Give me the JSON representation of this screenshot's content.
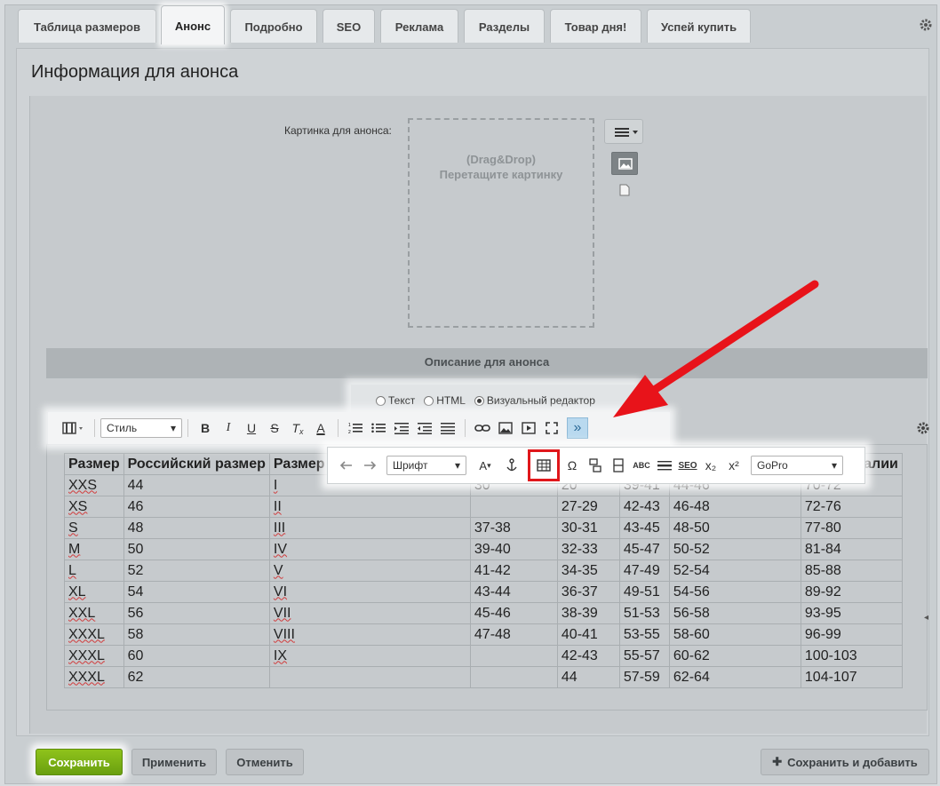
{
  "tabs": [
    "Таблица размеров",
    "Анонс",
    "Подробно",
    "SEO",
    "Реклама",
    "Разделы",
    "Товар дня!",
    "Успей купить"
  ],
  "active_tab": "Анонс",
  "page_title": "Информация для анонса",
  "picture": {
    "label": "Картинка для анонса:",
    "drop_line1": "(Drag&Drop)",
    "drop_line2": "Перетащите картинку"
  },
  "section_title": "Описание для анонса",
  "modes": [
    "Текст",
    "HTML",
    "Визуальный редактор"
  ],
  "selected_mode": "Визуальный редактор",
  "toolbar": {
    "style_select": "Стиль",
    "font_select": "Шрифт",
    "template_select": "GoPro",
    "font_size_label": "A",
    "more_label": "»",
    "subscript_label": "x₂",
    "superscript_label": "x²",
    "seo_label": "SEO",
    "spell_label": "ABC",
    "omega_label": "Ω"
  },
  "table": {
    "headers": [
      "Размер",
      "Российский размер",
      "Размер р",
      "",
      "",
      "",
      "",
      "алии"
    ],
    "rows": [
      [
        "XXS",
        "44",
        "I",
        "30",
        "20",
        "39-41",
        "44-46",
        "70-72"
      ],
      [
        "XS",
        "46",
        "II",
        "",
        "27-29",
        "42-43",
        "46-48",
        "72-76"
      ],
      [
        "S",
        "48",
        "III",
        "37-38",
        "30-31",
        "43-45",
        "48-50",
        "77-80"
      ],
      [
        "M",
        "50",
        "IV",
        "39-40",
        "32-33",
        "45-47",
        "50-52",
        "81-84"
      ],
      [
        "L",
        "52",
        "V",
        "41-42",
        "34-35",
        "47-49",
        "52-54",
        "85-88"
      ],
      [
        "XL",
        "54",
        "VI",
        "43-44",
        "36-37",
        "49-51",
        "54-56",
        "89-92"
      ],
      [
        "XXL",
        "56",
        "VII",
        "45-46",
        "38-39",
        "51-53",
        "56-58",
        "93-95"
      ],
      [
        "XXXL",
        "58",
        "VIII",
        "47-48",
        "40-41",
        "53-55",
        "58-60",
        "96-99"
      ],
      [
        "XXXL",
        "60",
        "IX",
        "",
        "42-43",
        "55-57",
        "60-62",
        "100-103"
      ],
      [
        "XXXL",
        "62",
        "",
        "",
        "44",
        "57-59",
        "62-64",
        "104-107"
      ]
    ]
  },
  "buttons": {
    "save": "Сохранить",
    "apply": "Применить",
    "cancel": "Отменить",
    "save_add": "Сохранить и добавить"
  },
  "colors": {
    "save_green": "#7cb518",
    "highlight_red": "#e0171b",
    "arrow_red": "#e8131a"
  }
}
